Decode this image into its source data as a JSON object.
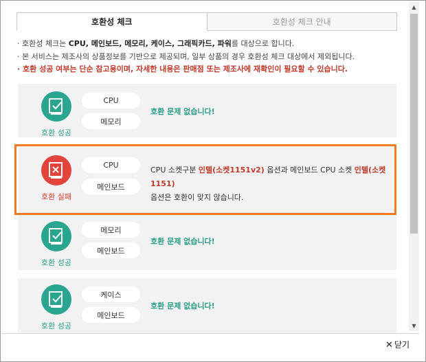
{
  "tabs": [
    {
      "label": "호환성 체크"
    },
    {
      "label": "호환성 체크 안내"
    }
  ],
  "notes": {
    "line1_prefix": "· 호환성 체크는 ",
    "line1_bold": "CPU, 메인보드, 메모리, 케이스, 그래픽카드, 파워",
    "line1_suffix": "를 대상으로 합니다.",
    "line2": "· 본 서비스는 제조사의 상품정보를 기반으로 제공되며, 일부 상품의 경우 호환성 체크 대상에서 제외됩니다.",
    "line3": "· 호환 성공 여부는 단순 참고용이며, 자세한 내용은 판매점 또는 제조사에 재확인이 필요할 수 있습니다."
  },
  "results": [
    {
      "status": "호환 성공",
      "items": [
        "CPU",
        "메모리"
      ],
      "message": "호환 문제 없습니다!"
    },
    {
      "status": "호환 실패",
      "items": [
        "CPU",
        "메인보드"
      ],
      "message_parts": {
        "p1": "CPU 소켓구분 ",
        "h1": "인텔(소켓1151v2)",
        "p2": " 옵션과 메인보드 CPU 소켓 ",
        "h2": "인텔(소켓1151)",
        "p3": " 옵션은 호환이 맞지 않습니다."
      }
    },
    {
      "status": "호환 성공",
      "items": [
        "메모리",
        "메인보드"
      ],
      "message": "호환 문제 없습니다!"
    },
    {
      "status": "호환 성공",
      "items": [
        "케이스",
        "메인보드"
      ],
      "message": "호환 문제 없습니다!"
    }
  ],
  "footer": {
    "close_label": "닫기",
    "close_symbol": "✕"
  },
  "colors": {
    "success": "#2aa58f",
    "fail": "#e2433a",
    "highlight": "#f07b22"
  }
}
